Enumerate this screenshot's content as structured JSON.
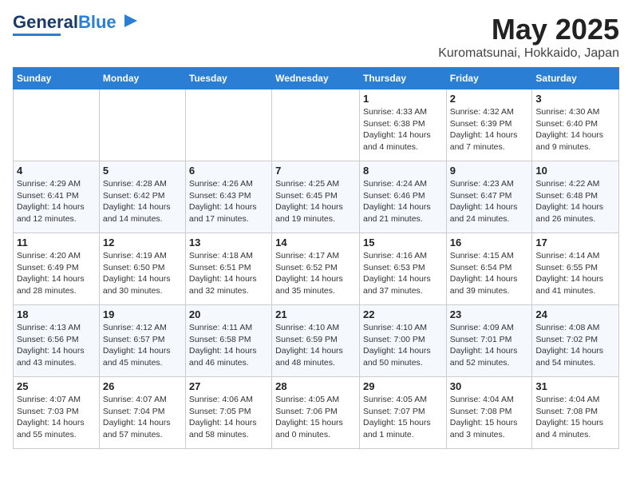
{
  "header": {
    "logo_line1": "General",
    "logo_line2": "Blue",
    "title": "May 2025",
    "subtitle": "Kuromatsunai, Hokkaido, Japan"
  },
  "weekdays": [
    "Sunday",
    "Monday",
    "Tuesday",
    "Wednesday",
    "Thursday",
    "Friday",
    "Saturday"
  ],
  "weeks": [
    [
      {
        "day": "",
        "info": ""
      },
      {
        "day": "",
        "info": ""
      },
      {
        "day": "",
        "info": ""
      },
      {
        "day": "",
        "info": ""
      },
      {
        "day": "1",
        "info": "Sunrise: 4:33 AM\nSunset: 6:38 PM\nDaylight: 14 hours\nand 4 minutes."
      },
      {
        "day": "2",
        "info": "Sunrise: 4:32 AM\nSunset: 6:39 PM\nDaylight: 14 hours\nand 7 minutes."
      },
      {
        "day": "3",
        "info": "Sunrise: 4:30 AM\nSunset: 6:40 PM\nDaylight: 14 hours\nand 9 minutes."
      }
    ],
    [
      {
        "day": "4",
        "info": "Sunrise: 4:29 AM\nSunset: 6:41 PM\nDaylight: 14 hours\nand 12 minutes."
      },
      {
        "day": "5",
        "info": "Sunrise: 4:28 AM\nSunset: 6:42 PM\nDaylight: 14 hours\nand 14 minutes."
      },
      {
        "day": "6",
        "info": "Sunrise: 4:26 AM\nSunset: 6:43 PM\nDaylight: 14 hours\nand 17 minutes."
      },
      {
        "day": "7",
        "info": "Sunrise: 4:25 AM\nSunset: 6:45 PM\nDaylight: 14 hours\nand 19 minutes."
      },
      {
        "day": "8",
        "info": "Sunrise: 4:24 AM\nSunset: 6:46 PM\nDaylight: 14 hours\nand 21 minutes."
      },
      {
        "day": "9",
        "info": "Sunrise: 4:23 AM\nSunset: 6:47 PM\nDaylight: 14 hours\nand 24 minutes."
      },
      {
        "day": "10",
        "info": "Sunrise: 4:22 AM\nSunset: 6:48 PM\nDaylight: 14 hours\nand 26 minutes."
      }
    ],
    [
      {
        "day": "11",
        "info": "Sunrise: 4:20 AM\nSunset: 6:49 PM\nDaylight: 14 hours\nand 28 minutes."
      },
      {
        "day": "12",
        "info": "Sunrise: 4:19 AM\nSunset: 6:50 PM\nDaylight: 14 hours\nand 30 minutes."
      },
      {
        "day": "13",
        "info": "Sunrise: 4:18 AM\nSunset: 6:51 PM\nDaylight: 14 hours\nand 32 minutes."
      },
      {
        "day": "14",
        "info": "Sunrise: 4:17 AM\nSunset: 6:52 PM\nDaylight: 14 hours\nand 35 minutes."
      },
      {
        "day": "15",
        "info": "Sunrise: 4:16 AM\nSunset: 6:53 PM\nDaylight: 14 hours\nand 37 minutes."
      },
      {
        "day": "16",
        "info": "Sunrise: 4:15 AM\nSunset: 6:54 PM\nDaylight: 14 hours\nand 39 minutes."
      },
      {
        "day": "17",
        "info": "Sunrise: 4:14 AM\nSunset: 6:55 PM\nDaylight: 14 hours\nand 41 minutes."
      }
    ],
    [
      {
        "day": "18",
        "info": "Sunrise: 4:13 AM\nSunset: 6:56 PM\nDaylight: 14 hours\nand 43 minutes."
      },
      {
        "day": "19",
        "info": "Sunrise: 4:12 AM\nSunset: 6:57 PM\nDaylight: 14 hours\nand 45 minutes."
      },
      {
        "day": "20",
        "info": "Sunrise: 4:11 AM\nSunset: 6:58 PM\nDaylight: 14 hours\nand 46 minutes."
      },
      {
        "day": "21",
        "info": "Sunrise: 4:10 AM\nSunset: 6:59 PM\nDaylight: 14 hours\nand 48 minutes."
      },
      {
        "day": "22",
        "info": "Sunrise: 4:10 AM\nSunset: 7:00 PM\nDaylight: 14 hours\nand 50 minutes."
      },
      {
        "day": "23",
        "info": "Sunrise: 4:09 AM\nSunset: 7:01 PM\nDaylight: 14 hours\nand 52 minutes."
      },
      {
        "day": "24",
        "info": "Sunrise: 4:08 AM\nSunset: 7:02 PM\nDaylight: 14 hours\nand 54 minutes."
      }
    ],
    [
      {
        "day": "25",
        "info": "Sunrise: 4:07 AM\nSunset: 7:03 PM\nDaylight: 14 hours\nand 55 minutes."
      },
      {
        "day": "26",
        "info": "Sunrise: 4:07 AM\nSunset: 7:04 PM\nDaylight: 14 hours\nand 57 minutes."
      },
      {
        "day": "27",
        "info": "Sunrise: 4:06 AM\nSunset: 7:05 PM\nDaylight: 14 hours\nand 58 minutes."
      },
      {
        "day": "28",
        "info": "Sunrise: 4:05 AM\nSunset: 7:06 PM\nDaylight: 15 hours\nand 0 minutes."
      },
      {
        "day": "29",
        "info": "Sunrise: 4:05 AM\nSunset: 7:07 PM\nDaylight: 15 hours\nand 1 minute."
      },
      {
        "day": "30",
        "info": "Sunrise: 4:04 AM\nSunset: 7:08 PM\nDaylight: 15 hours\nand 3 minutes."
      },
      {
        "day": "31",
        "info": "Sunrise: 4:04 AM\nSunset: 7:08 PM\nDaylight: 15 hours\nand 4 minutes."
      }
    ]
  ]
}
